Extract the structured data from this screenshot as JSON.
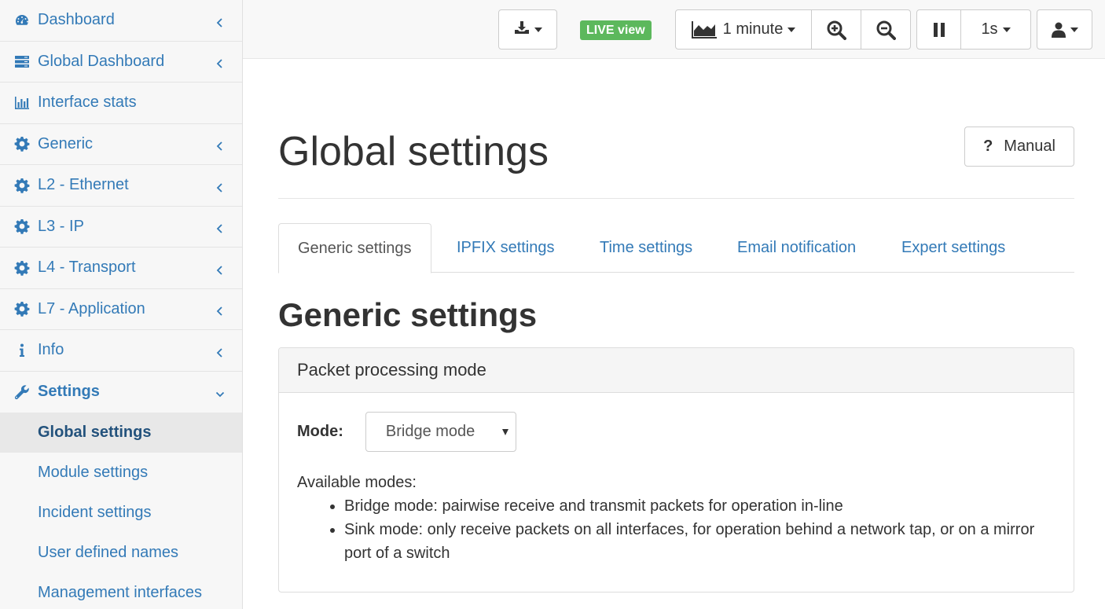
{
  "sidebar": {
    "items": [
      {
        "label": "Dashboard",
        "icon": "dashboard-icon",
        "chevron": "left"
      },
      {
        "label": "Global Dashboard",
        "icon": "server-icon",
        "chevron": "left"
      },
      {
        "label": "Interface stats",
        "icon": "bar-chart-icon",
        "chevron": ""
      },
      {
        "label": "Generic",
        "icon": "gear-icon",
        "chevron": "left"
      },
      {
        "label": "L2 - Ethernet",
        "icon": "gear-icon",
        "chevron": "left"
      },
      {
        "label": "L3 - IP",
        "icon": "gear-icon",
        "chevron": "left"
      },
      {
        "label": "L4 - Transport",
        "icon": "gear-icon",
        "chevron": "left"
      },
      {
        "label": "L7 - Application",
        "icon": "gear-icon",
        "chevron": "left"
      },
      {
        "label": "Info",
        "icon": "info-icon",
        "chevron": "left"
      },
      {
        "label": "Settings",
        "icon": "wrench-icon",
        "chevron": "down"
      }
    ],
    "subitems": [
      {
        "label": "Global settings",
        "current": true
      },
      {
        "label": "Module settings"
      },
      {
        "label": "Incident settings"
      },
      {
        "label": "User defined names"
      },
      {
        "label": "Management interfaces"
      }
    ]
  },
  "topbar": {
    "download_icon": "download-icon",
    "live_label": "LIVE view",
    "live_color": "#5cb85c",
    "timespan_label": "1 minute",
    "timespan_icon": "area-chart-icon",
    "zoom_in_icon": "zoom-in-icon",
    "zoom_out_icon": "zoom-out-icon",
    "pause_icon": "pause-icon",
    "refresh_label": "1s",
    "user_icon": "user-icon"
  },
  "main": {
    "title": "Global settings",
    "manual_label": "Manual",
    "tabs": [
      {
        "label": "Generic settings",
        "active": true
      },
      {
        "label": "IPFIX settings"
      },
      {
        "label": "Time settings"
      },
      {
        "label": "Email notification"
      },
      {
        "label": "Expert settings"
      }
    ],
    "section_title": "Generic settings",
    "panel": {
      "heading": "Packet processing mode",
      "mode_label": "Mode:",
      "mode_value": "Bridge mode",
      "available_label": "Available modes:",
      "modes": [
        "Bridge mode: pairwise receive and transmit packets for operation in-line",
        "Sink mode: only receive packets on all interfaces, for operation behind a network tap, or on a mirror port of a switch"
      ]
    }
  },
  "colors": {
    "link": "#337ab7",
    "accent_green": "#5cb85c"
  }
}
